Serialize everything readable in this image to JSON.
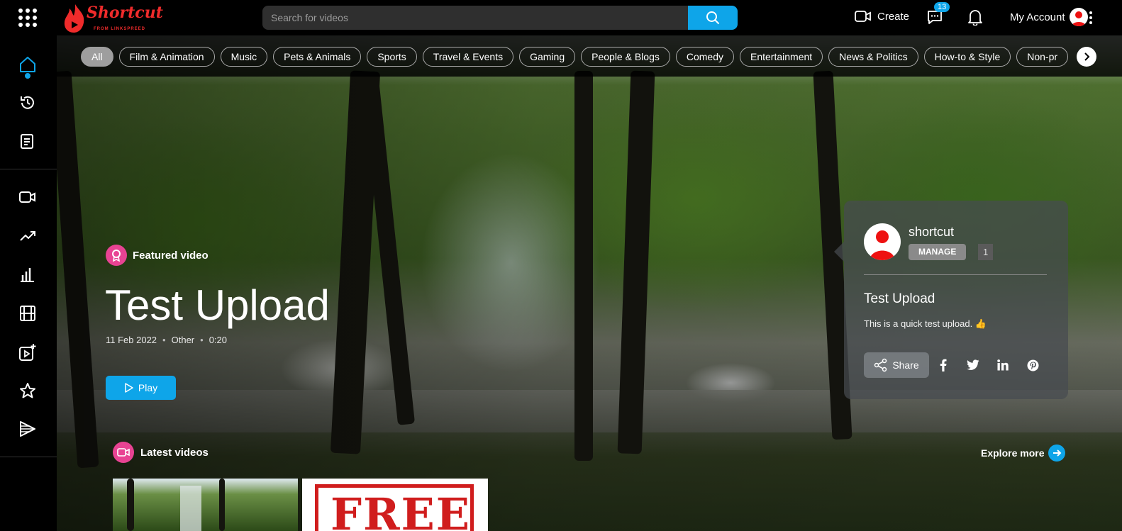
{
  "header": {
    "logo_text": "Shortcut",
    "logo_sub": "FROM LINKSPREED",
    "search_placeholder": "Search for videos",
    "create_label": "Create",
    "messages_count": "13",
    "account_label": "My Account"
  },
  "sidebar": {
    "items": [
      "home-icon",
      "history-icon",
      "playlist-icon",
      "video-icon",
      "trending-icon",
      "stats-icon",
      "film-icon",
      "add-video-icon",
      "star-icon",
      "media-icon"
    ],
    "active": "home-icon"
  },
  "categories": [
    "All",
    "Film & Animation",
    "Music",
    "Pets & Animals",
    "Sports",
    "Travel & Events",
    "Gaming",
    "People & Blogs",
    "Comedy",
    "Entertainment",
    "News & Politics",
    "How-to & Style",
    "Non-pr"
  ],
  "featured": {
    "label": "Featured video",
    "title": "Test Upload",
    "date": "11 Feb 2022",
    "category": "Other",
    "duration": "0:20",
    "play_label": "Play"
  },
  "card": {
    "channel": "shortcut",
    "manage_label": "MANAGE",
    "subscribers": "1",
    "title": "Test Upload",
    "description": "This is a quick test upload. 👍",
    "share_label": "Share",
    "social": [
      "facebook-icon",
      "twitter-icon",
      "linkedin-icon",
      "pinterest-icon"
    ]
  },
  "latest": {
    "label": "Latest videos",
    "explore_label": "Explore more",
    "thumb2_text": "FREE"
  },
  "colors": {
    "accent": "#0ea5e9",
    "brand": "#ef2b2b",
    "featured_badge": "#e84393"
  }
}
